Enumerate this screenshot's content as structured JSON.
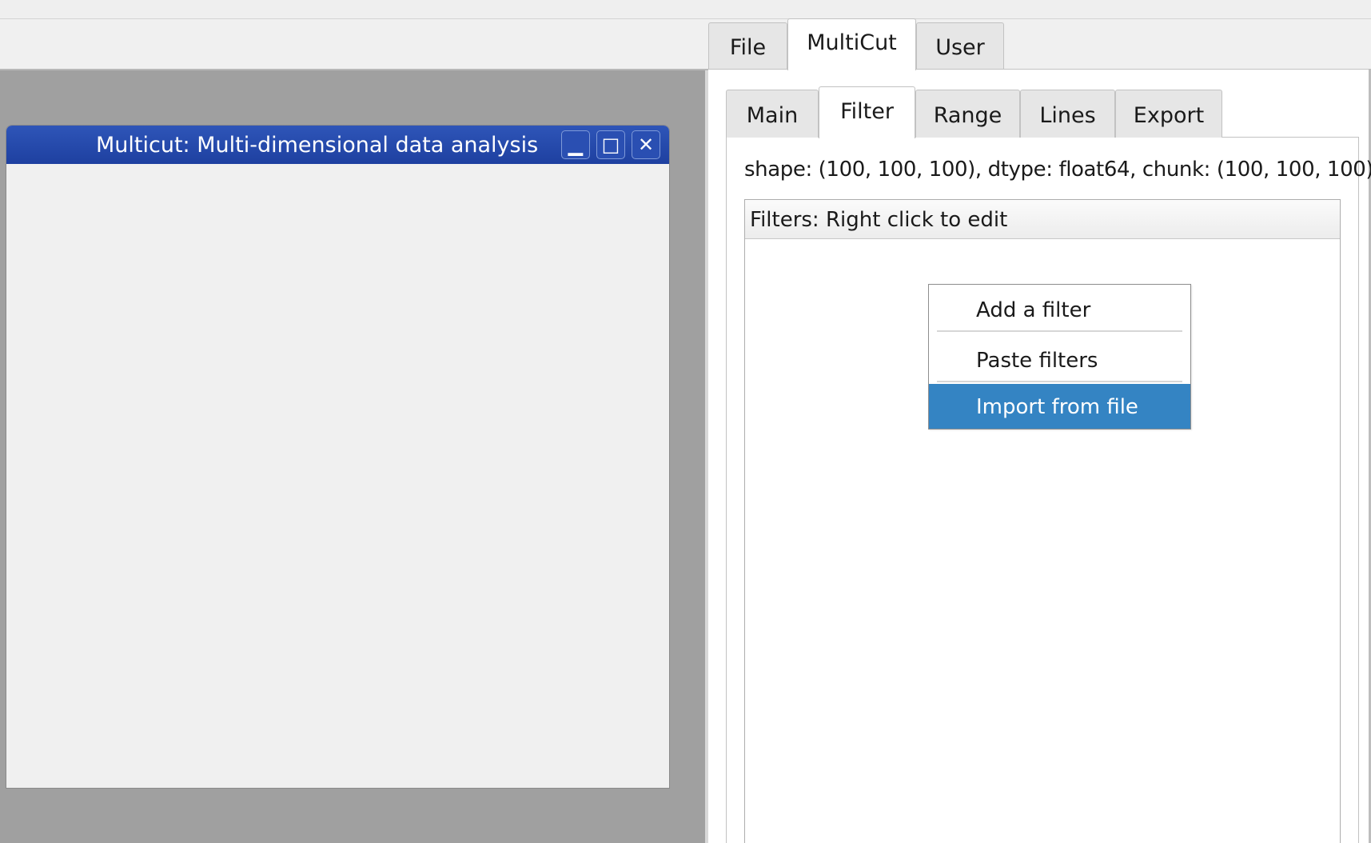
{
  "main_tabs": [
    {
      "label": "File",
      "active": false
    },
    {
      "label": "MultiCut",
      "active": true
    },
    {
      "label": "User",
      "active": false
    }
  ],
  "sub_tabs": [
    {
      "label": "Main",
      "active": false
    },
    {
      "label": "Filter",
      "active": true
    },
    {
      "label": "Range",
      "active": false
    },
    {
      "label": "Lines",
      "active": false
    },
    {
      "label": "Export",
      "active": false
    }
  ],
  "subwindow": {
    "title": "Multicut: Multi-dimensional data analysis",
    "minimize_symbol": "▁",
    "maximize_symbol": "□",
    "close_symbol": "✕"
  },
  "dataset_info": "shape: (100, 100, 100), dtype: float64, chunk: (100, 100, 100)",
  "filters_header": "Filters: Right click to edit",
  "context_menu": {
    "items": [
      "Add a filter",
      "Paste filters",
      "Import from file"
    ],
    "highlighted_index": 2
  },
  "colors": {
    "title_bar": "#1e40a0",
    "menu_highlight": "#3484c3",
    "mdi_background": "#a0a0a0"
  }
}
